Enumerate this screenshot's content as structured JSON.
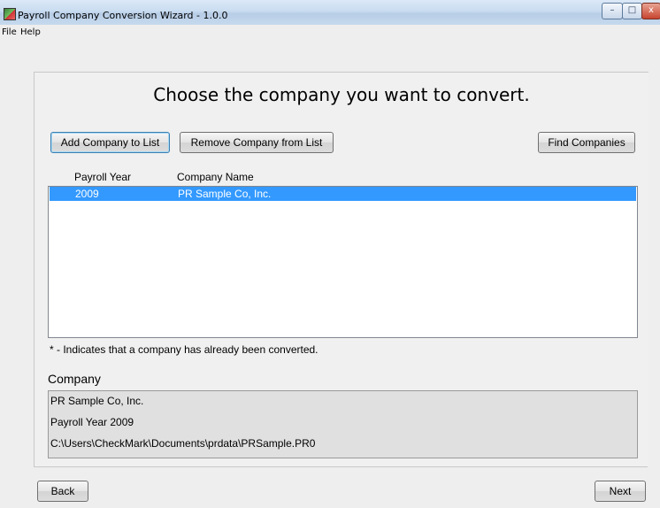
{
  "window": {
    "title": "Payroll Company Conversion Wizard - 1.0.0",
    "controls": {
      "minimize": "–",
      "maximize": "□",
      "close": "x"
    }
  },
  "menu": [
    "File",
    "Help"
  ],
  "wizard": {
    "heading": "Choose the company you want to convert.",
    "buttons": {
      "add": "Add Company to List",
      "remove": "Remove Company from List",
      "find": "Find Companies"
    },
    "table": {
      "columns": [
        "Payroll Year",
        "Company Name"
      ],
      "rows": [
        {
          "year": "2009",
          "name": "PR Sample Co, Inc.",
          "selected": true
        }
      ]
    },
    "note": "* - Indicates that a company has already been converted.",
    "company_section": {
      "label": "Company",
      "lines": [
        "PR Sample Co, Inc.",
        "Payroll Year 2009",
        "C:\\Users\\CheckMark\\Documents\\prdata\\PRSample.PR0"
      ]
    }
  },
  "footer": {
    "back": "Back",
    "next": "Next"
  },
  "colors": {
    "selection": "#3399ff",
    "titlebar": "#c9dcf0",
    "panel": "#e0e0e0"
  },
  "icons": {
    "app": "payroll-app-icon"
  }
}
